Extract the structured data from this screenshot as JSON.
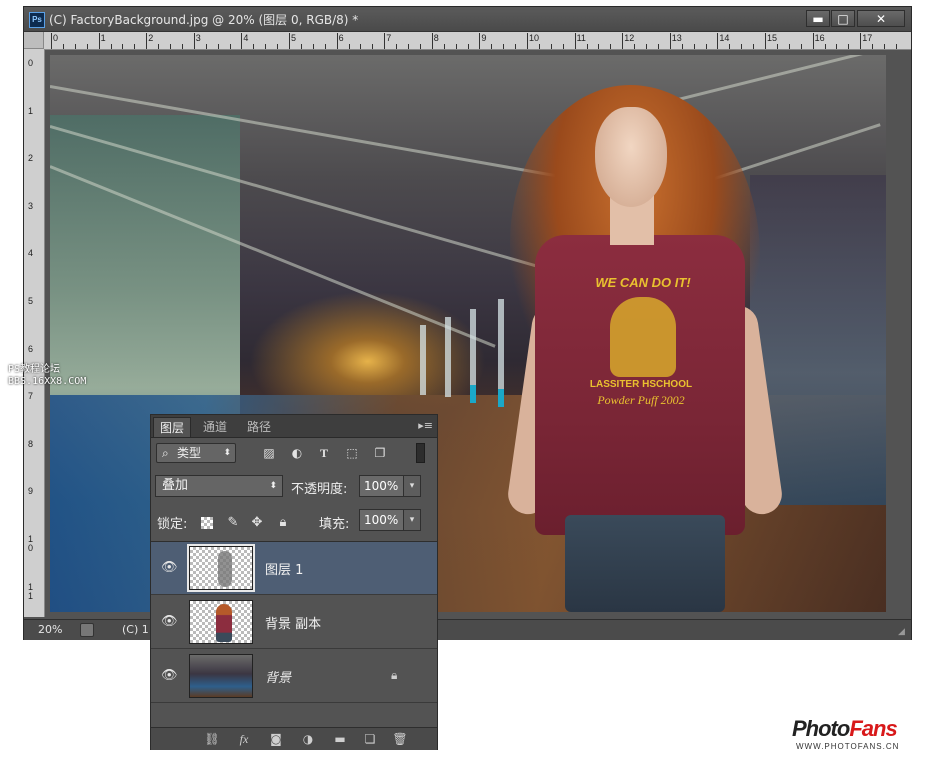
{
  "window": {
    "title": "(C) FactoryBackground.jpg @ 20% (图层 0, RGB/8) *",
    "app_icon": "Ps",
    "buttons": {
      "minimize": "▬",
      "maximize": "□",
      "close": "✕"
    }
  },
  "ruler": {
    "top_labels": [
      "0",
      "1",
      "2",
      "3",
      "4",
      "5",
      "6",
      "7",
      "8",
      "9",
      "10",
      "11",
      "12",
      "13",
      "14",
      "15",
      "16",
      "17"
    ],
    "left_labels": [
      "0",
      "1",
      "2",
      "3",
      "4",
      "5",
      "6",
      "7",
      "8",
      "9",
      "1\n0",
      "1\n1"
    ]
  },
  "image": {
    "shirt_slogan": "WE CAN DO IT!",
    "shirt_school": "LASSITER HSCHOOL",
    "shirt_year": "Powder Puff 2002"
  },
  "statusbar": {
    "zoom": "20%",
    "doc": "(C) 1"
  },
  "watermark": {
    "line1": "PS教程论坛",
    "line2": "BBS.16XX8.COM"
  },
  "layers_panel": {
    "tabs": [
      {
        "label": "图层",
        "active": true
      },
      {
        "label": "通道",
        "active": false
      },
      {
        "label": "路径",
        "active": false
      }
    ],
    "menu_icon": "▸≡",
    "filter": {
      "label": "类型",
      "search_icon": "⌕",
      "arrow": "⬍"
    },
    "blend_mode": {
      "value": "叠加",
      "arrow": "⬍"
    },
    "opacity": {
      "label": "不透明度:",
      "value": "100%",
      "arrow": "▾"
    },
    "lock": {
      "label": "锁定:"
    },
    "fill": {
      "label": "填充:",
      "value": "100%",
      "arrow": "▾"
    },
    "layers": [
      {
        "name": "图层 1",
        "selected": true,
        "visible": true
      },
      {
        "name": "背景 副本",
        "selected": false,
        "visible": true
      },
      {
        "name": "背景",
        "selected": false,
        "visible": true,
        "locked": true
      }
    ],
    "footer_icons": [
      "link-icon",
      "fx-icon",
      "mask-icon",
      "adjustment-icon",
      "folder-icon",
      "new-layer-icon",
      "trash-icon"
    ]
  },
  "logo": {
    "photo": "Photo",
    "fans": "Fans",
    "url": "WWW.PHOTOFANS.CN"
  }
}
